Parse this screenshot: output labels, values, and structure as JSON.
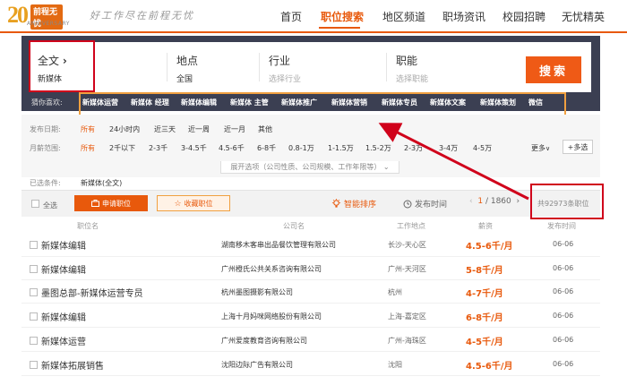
{
  "header": {
    "logo_number": "20",
    "logo_brand": "前程无忧",
    "logo_anniversary": "ANNIVERSARY",
    "slogan": "好工作尽在前程无忧",
    "nav": [
      "首页",
      "职位搜索",
      "地区频道",
      "职场资讯",
      "校园招聘",
      "无忧精英"
    ],
    "active_nav": "职位搜索"
  },
  "search": {
    "fulltext_label": "全文",
    "fulltext_arrow": "›",
    "fulltext_value": "新媒体",
    "location_label": "地点",
    "location_value": "全国",
    "industry_label": "行业",
    "industry_placeholder": "选择行业",
    "function_label": "职能",
    "function_placeholder": "选择职能",
    "button": "搜索",
    "hot_label": "猜你喜欢:",
    "hot_terms": [
      "新媒体运营",
      "新媒体 经理",
      "新媒体编辑",
      "新媒体 主管",
      "新媒体推广",
      "新媒体营销",
      "新媒体专员",
      "新媒体文案",
      "新媒体策划",
      "微信"
    ]
  },
  "filters": {
    "date_label": "发布日期:",
    "date_options": [
      "所有",
      "24小时内",
      "近三天",
      "近一周",
      "近一月",
      "其他"
    ],
    "salary_label": "月薪范围:",
    "salary_options": [
      "所有",
      "2千以下",
      "2-3千",
      "3-4.5千",
      "4.5-6千",
      "6-8千",
      "0.8-1万",
      "1-1.5万",
      "1.5-2万",
      "2-3万",
      "3-4万",
      "4-5万"
    ],
    "more": "更多",
    "more_arrow": "∨",
    "multi": "+多选",
    "expand": "展开选项（公司性质、公司规模、工作年限等）"
  },
  "conditions": {
    "label": "已选条件:",
    "value": "新媒体(全文)"
  },
  "toolbar": {
    "select_all": "全选",
    "apply": "申请职位",
    "favorite": "收藏职位",
    "smart_sort": "智能排序",
    "publish_time": "发布时间",
    "page_current": "1",
    "page_total": "/ 1860",
    "total_text": "共92973条职位"
  },
  "table": {
    "headers": [
      "职位名",
      "公司名",
      "工作地点",
      "薪资",
      "发布时间"
    ],
    "rows": [
      {
        "title": "新媒体编辑",
        "company": "湖南移木客串出品餐饮管理有限公司",
        "location": "长沙-天心区",
        "salary": "4.5-6千/月",
        "date": "06-06"
      },
      {
        "title": "新媒体编辑",
        "company": "广州橙氏公共关系咨询有限公司",
        "location": "广州-天河区",
        "salary": "5-8千/月",
        "date": "06-06"
      },
      {
        "title": "墨图总部-新媒体运营专员",
        "company": "杭州墨图摄影有限公司",
        "location": "杭州",
        "salary": "4-7千/月",
        "date": "06-06"
      },
      {
        "title": "新媒体编辑",
        "company": "上海十月妈咪网络股份有限公司",
        "location": "上海-嘉定区",
        "salary": "6-8千/月",
        "date": "06-06"
      },
      {
        "title": "新媒体运营",
        "company": "广州爱度教育咨询有限公司",
        "location": "广州-海珠区",
        "salary": "4-5千/月",
        "date": "06-06"
      },
      {
        "title": "新媒体拓展销售",
        "company": "沈阳边际广告有限公司",
        "location": "沈阳",
        "salary": "4.5-6千/月",
        "date": "06-06"
      }
    ]
  },
  "colors": {
    "accent": "#e8590c",
    "highlight_red": "#d0021b",
    "panel": "#3b3f52"
  }
}
